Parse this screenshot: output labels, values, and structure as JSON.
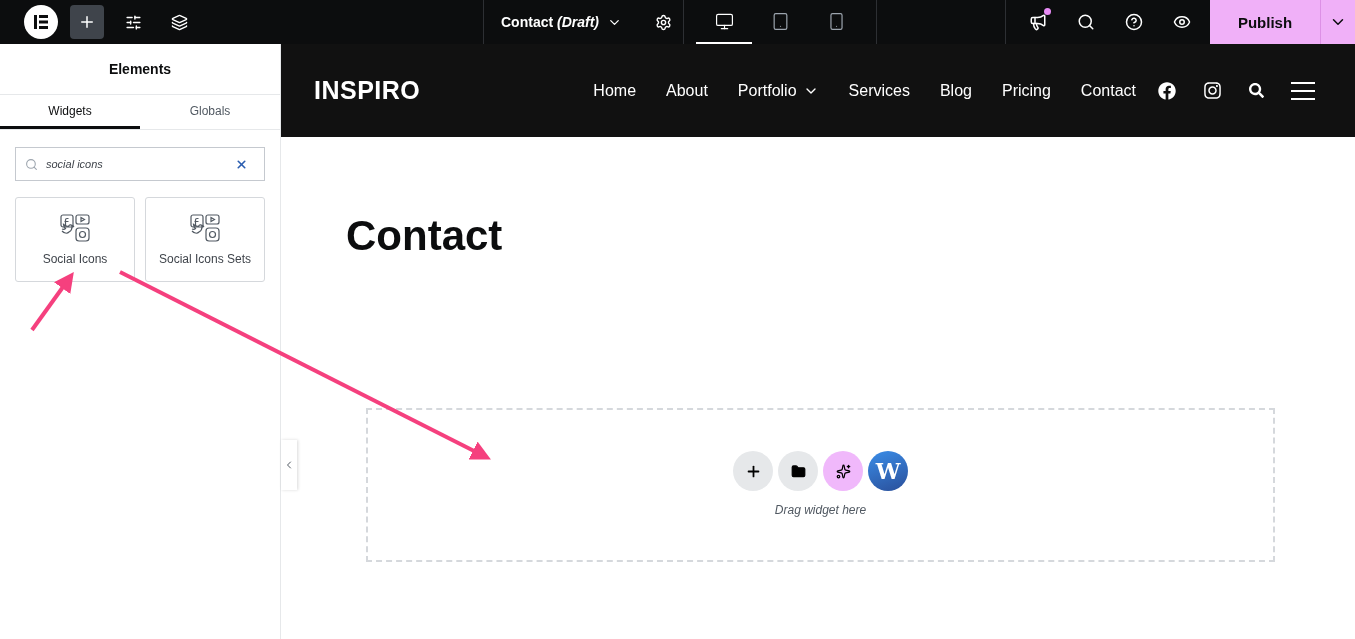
{
  "topbar": {
    "document_title": "Contact *(Draft)*",
    "devices": [
      {
        "kind": "desktop",
        "selected": true
      },
      {
        "kind": "tablet",
        "selected": false
      },
      {
        "kind": "mobile",
        "selected": false
      }
    ],
    "notification": true,
    "publish_label": "Publish"
  },
  "panel": {
    "title": "Elements",
    "tabs": [
      {
        "label": "Widgets",
        "selected": true
      },
      {
        "label": "Globals",
        "selected": false
      }
    ],
    "search": {
      "value": "social icons"
    },
    "widgets": [
      "Social Icons",
      "Social Icons Sets"
    ]
  },
  "site": {
    "brand": "INSPIRO",
    "nav": [
      {
        "label": "Home",
        "has_menu": false
      },
      {
        "label": "About",
        "has_menu": false
      },
      {
        "label": "Portfolio",
        "has_menu": true
      },
      {
        "label": "Services",
        "has_menu": false
      },
      {
        "label": "Blog",
        "has_menu": false
      },
      {
        "label": "Pricing",
        "has_menu": false
      },
      {
        "label": "Contact",
        "has_menu": false
      }
    ],
    "heading": "Contact",
    "dropzone": {
      "badge_letter": "W",
      "hint": "Drag widget here"
    }
  }
}
